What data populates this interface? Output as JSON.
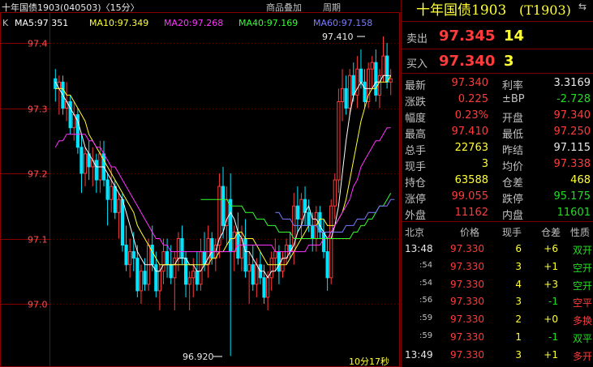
{
  "chart": {
    "title": "十年国债1903(040503)〈15分〉",
    "tabs": [
      "商品叠加",
      "周期"
    ],
    "indicator_k": "K",
    "ma": [
      {
        "label": "MA5:97.351",
        "color": "#ffffff"
      },
      {
        "label": "MA10:97.349",
        "color": "#ffff33"
      },
      {
        "label": "MA20:97.268",
        "color": "#ff33ff"
      },
      {
        "label": "MA40:97.169",
        "color": "#33ff33"
      },
      {
        "label": "MA60:97.158",
        "color": "#7b7bff"
      }
    ],
    "high_label": "97.410",
    "low_label": "96.920",
    "countdown": "10分17秒"
  },
  "chart_data": {
    "type": "candlestick",
    "title": "十年国债1903(040503)〈15分〉",
    "ylim": [
      96.92,
      97.45
    ],
    "yticks": [
      "97.4",
      "97.3",
      "97.2",
      "97.1",
      "97.0"
    ],
    "yticks_values": [
      97.4,
      97.3,
      97.2,
      97.1,
      97.0
    ],
    "up_color": "#ff3b3b",
    "down_color": "#00e5ff",
    "candles": [
      [
        97.345,
        97.36,
        97.31,
        97.33
      ],
      [
        97.33,
        97.35,
        97.29,
        97.34
      ],
      [
        97.34,
        97.35,
        97.29,
        97.3
      ],
      [
        97.3,
        97.34,
        97.28,
        97.31
      ],
      [
        97.31,
        97.32,
        97.26,
        97.27
      ],
      [
        97.27,
        97.31,
        97.25,
        97.29
      ],
      [
        97.29,
        97.3,
        97.23,
        97.24
      ],
      [
        97.24,
        97.26,
        97.17,
        97.2
      ],
      [
        97.2,
        97.24,
        97.18,
        97.23
      ],
      [
        97.23,
        97.25,
        97.19,
        97.21
      ],
      [
        97.21,
        97.24,
        97.18,
        97.22
      ],
      [
        97.22,
        97.23,
        97.17,
        97.19
      ],
      [
        97.19,
        97.25,
        97.17,
        97.23
      ],
      [
        97.23,
        97.25,
        97.18,
        97.19
      ],
      [
        97.19,
        97.2,
        97.12,
        97.16
      ],
      [
        97.16,
        97.21,
        97.14,
        97.18
      ],
      [
        97.18,
        97.19,
        97.13,
        97.14
      ],
      [
        97.14,
        97.17,
        97.1,
        97.16
      ],
      [
        97.16,
        97.17,
        97.08,
        97.09
      ],
      [
        97.09,
        97.12,
        97.05,
        97.06
      ],
      [
        97.06,
        97.1,
        97.04,
        97.08
      ],
      [
        97.08,
        97.11,
        97.05,
        97.07
      ],
      [
        97.07,
        97.09,
        97.01,
        97.02
      ],
      [
        97.02,
        97.06,
        97.0,
        97.05
      ],
      [
        97.05,
        97.07,
        97.02,
        97.03
      ],
      [
        97.03,
        97.1,
        97.02,
        97.09
      ],
      [
        97.09,
        97.12,
        97.05,
        97.06
      ],
      [
        97.06,
        97.08,
        97.01,
        97.02
      ],
      [
        97.02,
        97.06,
        96.99,
        97.05
      ],
      [
        97.05,
        97.1,
        97.03,
        97.08
      ],
      [
        97.08,
        97.1,
        97.04,
        97.06
      ],
      [
        97.06,
        97.09,
        97.03,
        97.04
      ],
      [
        97.04,
        97.08,
        96.99,
        97.07
      ],
      [
        97.07,
        97.11,
        97.05,
        97.1
      ],
      [
        97.1,
        97.12,
        97.06,
        97.07
      ],
      [
        97.07,
        97.08,
        97.01,
        97.03
      ],
      [
        97.03,
        97.05,
        96.99,
        97.04
      ],
      [
        97.04,
        97.07,
        97.01,
        97.05
      ],
      [
        97.05,
        97.08,
        97.02,
        97.03
      ],
      [
        97.03,
        97.1,
        97.02,
        97.08
      ],
      [
        97.08,
        97.11,
        97.05,
        97.06
      ],
      [
        97.06,
        97.12,
        97.04,
        97.1
      ],
      [
        97.1,
        97.11,
        97.06,
        97.07
      ],
      [
        97.07,
        97.1,
        97.05,
        97.09
      ],
      [
        97.09,
        97.2,
        97.07,
        97.18
      ],
      [
        97.18,
        97.21,
        97.1,
        97.12
      ],
      [
        97.12,
        97.18,
        97.09,
        97.16
      ],
      [
        97.16,
        97.2,
        96.92,
        97.08
      ],
      [
        97.08,
        97.12,
        97.05,
        97.11
      ],
      [
        97.11,
        97.14,
        97.06,
        97.07
      ],
      [
        97.07,
        97.12,
        97.05,
        97.1
      ],
      [
        97.1,
        97.13,
        97.04,
        97.05
      ],
      [
        97.05,
        97.08,
        97.0,
        97.06
      ],
      [
        97.06,
        97.09,
        97.02,
        97.03
      ],
      [
        97.03,
        97.07,
        97.01,
        97.06
      ],
      [
        97.06,
        97.08,
        97.03,
        97.04
      ],
      [
        97.04,
        97.06,
        97.0,
        97.01
      ],
      [
        97.01,
        97.05,
        96.99,
        97.04
      ],
      [
        97.04,
        97.08,
        97.02,
        97.07
      ],
      [
        97.07,
        97.1,
        97.05,
        97.08
      ],
      [
        97.08,
        97.09,
        97.03,
        97.05
      ],
      [
        97.05,
        97.08,
        97.04,
        97.07
      ],
      [
        97.07,
        97.1,
        97.06,
        97.09
      ],
      [
        97.09,
        97.11,
        97.07,
        97.08
      ],
      [
        97.08,
        97.17,
        97.06,
        97.15
      ],
      [
        97.15,
        97.18,
        97.11,
        97.13
      ],
      [
        97.13,
        97.17,
        97.1,
        97.16
      ],
      [
        97.16,
        97.18,
        97.12,
        97.14
      ],
      [
        97.14,
        97.16,
        97.11,
        97.12
      ],
      [
        97.12,
        97.14,
        97.08,
        97.1
      ],
      [
        97.1,
        97.15,
        97.08,
        97.14
      ],
      [
        97.14,
        97.15,
        97.1,
        97.11
      ],
      [
        97.11,
        97.13,
        97.07,
        97.08
      ],
      [
        97.08,
        97.1,
        97.02,
        97.04
      ],
      [
        97.04,
        97.16,
        97.03,
        97.15
      ],
      [
        97.15,
        97.2,
        97.13,
        97.19
      ],
      [
        97.19,
        97.33,
        97.17,
        97.31
      ],
      [
        97.31,
        97.36,
        97.28,
        97.33
      ],
      [
        97.33,
        97.35,
        97.29,
        97.3
      ],
      [
        97.3,
        97.36,
        97.29,
        97.35
      ],
      [
        97.35,
        97.37,
        97.31,
        97.32
      ],
      [
        97.32,
        97.38,
        97.3,
        97.36
      ],
      [
        97.36,
        97.39,
        97.33,
        97.34
      ],
      [
        97.34,
        97.36,
        97.3,
        97.31
      ],
      [
        97.31,
        97.37,
        97.3,
        97.36
      ],
      [
        97.36,
        97.38,
        97.33,
        97.37
      ],
      [
        97.37,
        97.39,
        97.31,
        97.32
      ],
      [
        97.32,
        97.36,
        97.3,
        97.35
      ],
      [
        97.35,
        97.41,
        97.34,
        97.38
      ],
      [
        97.38,
        97.4,
        97.33,
        97.34
      ],
      [
        97.34,
        97.36,
        97.32,
        97.345
      ]
    ],
    "ma_series": [
      {
        "name": "MA5",
        "color": "#ffffff",
        "values": [
          97.34,
          97.33,
          97.32,
          97.31,
          97.3,
          97.29,
          97.28,
          97.26,
          97.24,
          97.23,
          97.22,
          97.21,
          97.21,
          97.21,
          97.2,
          97.19,
          97.18,
          97.17,
          97.16,
          97.14,
          97.12,
          97.1,
          97.08,
          97.07,
          97.06,
          97.06,
          97.06,
          97.05,
          97.05,
          97.06,
          97.06,
          97.06,
          97.06,
          97.07,
          97.07,
          97.07,
          97.06,
          97.06,
          97.05,
          97.05,
          97.06,
          97.07,
          97.08,
          97.08,
          97.1,
          97.11,
          97.13,
          97.14,
          97.13,
          97.11,
          97.1,
          97.08,
          97.08,
          97.07,
          97.06,
          97.05,
          97.05,
          97.04,
          97.05,
          97.05,
          97.06,
          97.07,
          97.07,
          97.08,
          97.09,
          97.11,
          97.12,
          97.14,
          97.15,
          97.13,
          97.13,
          97.12,
          97.11,
          97.1,
          97.1,
          97.12,
          97.15,
          97.2,
          97.25,
          97.29,
          97.32,
          97.33,
          97.34,
          97.33,
          97.33,
          97.33,
          97.34,
          97.34,
          97.35,
          97.35,
          97.35
        ]
      },
      {
        "name": "MA10",
        "color": "#ffff33",
        "values": [
          97.33,
          97.33,
          97.33,
          97.32,
          97.32,
          97.31,
          97.3,
          97.29,
          97.28,
          97.26,
          97.25,
          97.24,
          97.23,
          97.22,
          97.21,
          97.2,
          97.19,
          97.18,
          97.17,
          97.16,
          97.15,
          97.14,
          97.12,
          97.11,
          97.1,
          97.09,
          97.08,
          97.07,
          97.06,
          97.06,
          97.06,
          97.06,
          97.06,
          97.06,
          97.06,
          97.06,
          97.06,
          97.06,
          97.06,
          97.06,
          97.06,
          97.06,
          97.07,
          97.07,
          97.08,
          97.08,
          97.09,
          97.1,
          97.1,
          97.11,
          97.11,
          97.1,
          97.1,
          97.1,
          97.09,
          97.08,
          97.07,
          97.06,
          97.06,
          97.06,
          97.06,
          97.06,
          97.06,
          97.07,
          97.08,
          97.09,
          97.1,
          97.11,
          97.12,
          97.12,
          97.12,
          97.13,
          97.13,
          97.12,
          97.12,
          97.12,
          97.13,
          97.14,
          97.16,
          97.19,
          97.22,
          97.25,
          97.28,
          97.3,
          97.32,
          97.33,
          97.33,
          97.34,
          97.34,
          97.34,
          97.35
        ]
      },
      {
        "name": "MA20",
        "color": "#ff33ff",
        "values": [
          97.24,
          97.25,
          97.25,
          97.26,
          97.26,
          97.26,
          97.26,
          97.26,
          97.26,
          97.25,
          97.25,
          97.24,
          97.24,
          97.23,
          97.22,
          97.21,
          97.21,
          97.2,
          97.19,
          97.18,
          97.17,
          97.16,
          97.15,
          97.14,
          97.13,
          97.12,
          97.11,
          97.1,
          97.1,
          97.09,
          97.09,
          97.08,
          97.08,
          97.08,
          97.08,
          97.08,
          97.08,
          97.08,
          97.08,
          97.08,
          97.08,
          97.08,
          97.08,
          97.08,
          97.08,
          97.08,
          97.08,
          97.08,
          97.08,
          97.09,
          97.09,
          97.09,
          97.09,
          97.09,
          97.09,
          97.09,
          97.09,
          97.09,
          97.09,
          97.08,
          97.08,
          97.08,
          97.08,
          97.08,
          97.08,
          97.08,
          97.08,
          97.08,
          97.09,
          97.09,
          97.09,
          97.09,
          97.1,
          97.1,
          97.11,
          97.12,
          97.13,
          97.14,
          97.15,
          97.16,
          97.18,
          97.19,
          97.21,
          97.22,
          97.23,
          97.24,
          97.25,
          97.25,
          97.26,
          97.27,
          97.27
        ]
      },
      {
        "name": "MA40",
        "color": "#33ff33",
        "values": [
          null,
          null,
          null,
          null,
          null,
          null,
          null,
          null,
          null,
          null,
          null,
          null,
          null,
          null,
          null,
          null,
          null,
          null,
          null,
          null,
          null,
          null,
          null,
          null,
          null,
          null,
          null,
          null,
          null,
          null,
          null,
          null,
          null,
          null,
          null,
          null,
          null,
          null,
          null,
          97.16,
          97.16,
          97.16,
          97.16,
          97.16,
          97.16,
          97.16,
          97.16,
          97.15,
          97.15,
          97.15,
          97.15,
          97.14,
          97.14,
          97.14,
          97.13,
          97.13,
          97.13,
          97.12,
          97.12,
          97.12,
          97.11,
          97.11,
          97.11,
          97.11,
          97.1,
          97.1,
          97.1,
          97.1,
          97.1,
          97.1,
          97.1,
          97.1,
          97.1,
          97.1,
          97.1,
          97.1,
          97.1,
          97.1,
          97.1,
          97.1,
          97.11,
          97.11,
          97.12,
          97.12,
          97.13,
          97.13,
          97.14,
          97.15,
          97.15,
          97.16,
          97.17
        ]
      },
      {
        "name": "MA60",
        "color": "#7b7bff",
        "values": [
          null,
          null,
          null,
          null,
          null,
          null,
          null,
          null,
          null,
          null,
          null,
          null,
          null,
          null,
          null,
          null,
          null,
          null,
          null,
          null,
          null,
          null,
          null,
          null,
          null,
          null,
          null,
          null,
          null,
          null,
          null,
          null,
          null,
          null,
          null,
          null,
          null,
          null,
          null,
          null,
          null,
          null,
          null,
          null,
          null,
          null,
          null,
          null,
          null,
          null,
          null,
          null,
          null,
          null,
          null,
          null,
          null,
          null,
          null,
          97.14,
          97.14,
          97.13,
          97.13,
          97.13,
          97.12,
          97.12,
          97.12,
          97.12,
          97.12,
          97.12,
          97.12,
          97.11,
          97.11,
          97.11,
          97.11,
          97.11,
          97.11,
          97.11,
          97.12,
          97.12,
          97.12,
          97.13,
          97.13,
          97.13,
          97.14,
          97.14,
          97.14,
          97.15,
          97.15,
          97.15,
          97.16,
          97.16
        ]
      }
    ]
  },
  "quote": {
    "name": "十年国债1903",
    "code": "(T1903)",
    "sell_label": "卖出",
    "sell_price": "97.345",
    "sell_vol": "14",
    "buy_label": "买入",
    "buy_price": "97.340",
    "buy_vol": "3",
    "rows": [
      {
        "l1": "最新",
        "v1": "97.340",
        "c1": "red",
        "l2": "利率",
        "v2": "3.3169",
        "c2": "white"
      },
      {
        "l1": "涨跌",
        "v1": "0.225",
        "c1": "red",
        "l2": "±BP",
        "v2": "-2.728",
        "c2": "green"
      },
      {
        "l1": "幅度",
        "v1": "0.23%",
        "c1": "red",
        "l2": "开盘",
        "v2": "97.340",
        "c2": "red"
      },
      {
        "l1": "最高",
        "v1": "97.410",
        "c1": "red",
        "l2": "最低",
        "v2": "97.250",
        "c2": "red"
      },
      {
        "l1": "总手",
        "v1": "22763",
        "c1": "yellow",
        "l2": "昨结",
        "v2": "97.115",
        "c2": "white"
      },
      {
        "l1": "现手",
        "v1": "3",
        "c1": "yellow",
        "l2": "均价",
        "v2": "97.338",
        "c2": "red"
      },
      {
        "l1": "持仓",
        "v1": "63588",
        "c1": "yellow",
        "l2": "仓差",
        "v2": "468",
        "c2": "yellow"
      },
      {
        "l1": "涨停",
        "v1": "99.055",
        "c1": "red",
        "l2": "跌停",
        "v2": "95.175",
        "c2": "green"
      },
      {
        "l1": "外盘",
        "v1": "11162",
        "c1": "red",
        "l2": "内盘",
        "v2": "11601",
        "c2": "green"
      }
    ],
    "ticks_header": {
      "location": "北京",
      "price": "价格",
      "vol": "现手",
      "oi": "仓差",
      "nature": "性质"
    },
    "ticks": [
      {
        "time": "13:48",
        "price": "97.330",
        "vol": "6",
        "oi": "+6",
        "nature": "双开",
        "nc": "green"
      },
      {
        "time": ":54",
        "price": "97.330",
        "vol": "3",
        "oi": "+1",
        "nature": "空开",
        "nc": "green"
      },
      {
        "time": ":54",
        "price": "97.330",
        "vol": "4",
        "oi": "+3",
        "nature": "空开",
        "nc": "green"
      },
      {
        "time": ":56",
        "price": "97.330",
        "vol": "3",
        "oi": "-1",
        "nature": "空平",
        "nc": "red"
      },
      {
        "time": ":59",
        "price": "97.330",
        "vol": "2",
        "oi": "+0",
        "nature": "多换",
        "nc": "red"
      },
      {
        "time": ":59",
        "price": "97.330",
        "vol": "1",
        "oi": "-1",
        "nature": "双平",
        "nc": "green"
      },
      {
        "time": "13:49",
        "price": "97.330",
        "vol": "3",
        "oi": "+1",
        "nature": "多开",
        "nc": "red"
      }
    ]
  }
}
